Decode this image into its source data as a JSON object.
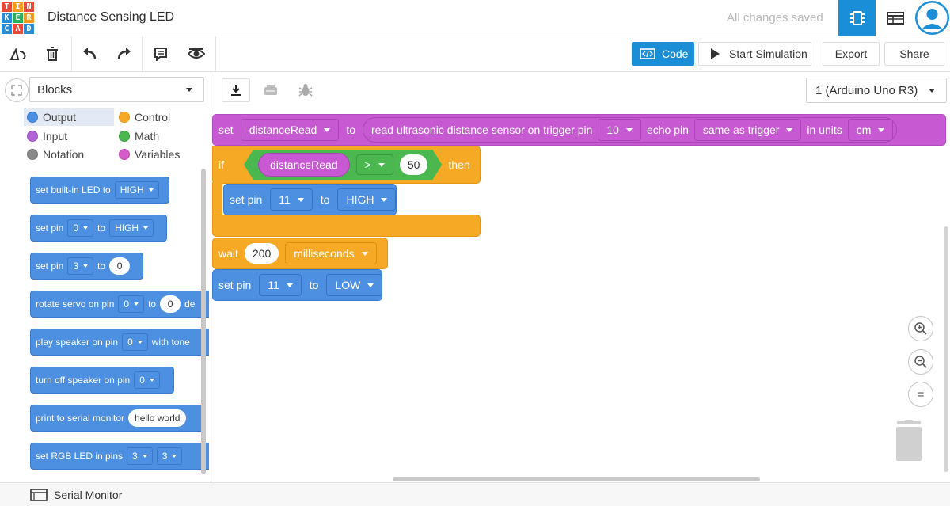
{
  "app": {
    "logo_letters": [
      "T",
      "I",
      "N",
      "K",
      "E",
      "R",
      "C",
      "A",
      "D"
    ],
    "title": "Distance Sensing LED",
    "save_status": "All changes saved"
  },
  "toolbar": {
    "code_label": "Code",
    "start_simulation_label": "Start Simulation",
    "export_label": "Export",
    "share_label": "Share"
  },
  "left_panel": {
    "blocks_select": "Blocks",
    "categories": [
      {
        "label": "Output",
        "color": "#4d8fe0"
      },
      {
        "label": "Control",
        "color": "#f6a925"
      },
      {
        "label": "Input",
        "color": "#b064d6"
      },
      {
        "label": "Math",
        "color": "#4ab84e"
      },
      {
        "label": "Notation",
        "color": "#888888"
      },
      {
        "label": "Variables",
        "color": "#d45bc8"
      }
    ],
    "palette": {
      "b1": {
        "text": "set built-in LED to",
        "val": "HIGH"
      },
      "b2": {
        "text": "set pin",
        "pin": "0",
        "to": "to",
        "val": "HIGH"
      },
      "b3": {
        "text": "set pin",
        "pin": "3",
        "to": "to",
        "val": "0"
      },
      "b4": {
        "text": "rotate servo on pin",
        "pin": "0",
        "to": "to",
        "val": "0",
        "tail": "de"
      },
      "b5": {
        "text": "play speaker on pin",
        "pin": "0",
        "tail": "with tone"
      },
      "b6": {
        "text": "turn off speaker on pin",
        "pin": "0"
      },
      "b7": {
        "text": "print to serial monitor",
        "val": "hello world"
      },
      "b8": {
        "text": "set RGB LED in pins",
        "pin1": "3",
        "pin2": "3"
      }
    }
  },
  "workspace": {
    "board_select": "1 (Arduino Uno R3)",
    "set_block": {
      "set": "set",
      "variable": "distanceRead",
      "to": "to",
      "read": "read ultrasonic distance sensor on trigger pin",
      "trigger_pin": "10",
      "echo": "echo pin",
      "echo_value": "same as trigger",
      "units_label": "in units",
      "units": "cm"
    },
    "if_block": {
      "if": "if",
      "variable": "distanceRead",
      "operator": ">",
      "value": "50",
      "then": "then"
    },
    "inner_set_pin": {
      "label": "set pin",
      "pin": "11",
      "to": "to",
      "value": "HIGH"
    },
    "wait_block": {
      "label": "wait",
      "value": "200",
      "unit": "milliseconds"
    },
    "last_set_pin": {
      "label": "set pin",
      "pin": "11",
      "to": "to",
      "value": "LOW"
    },
    "zoom": {
      "in": "+",
      "out": "−",
      "fit": "="
    }
  },
  "serial_monitor": {
    "label": "Serial Monitor"
  }
}
